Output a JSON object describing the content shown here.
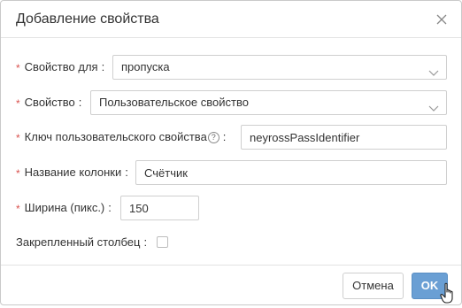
{
  "dialog": {
    "title": "Добавление свойства",
    "close_icon": "close-icon"
  },
  "form": {
    "required_mark": "*",
    "colon": ":",
    "property_for": {
      "label": "Свойство для",
      "value": "пропуска"
    },
    "property": {
      "label": "Свойство",
      "value": "Пользовательское свойство"
    },
    "custom_key": {
      "label": "Ключ пользовательского свойства",
      "help_icon": "help-icon",
      "help_glyph": "?",
      "value": "neyrossPassIdentifier"
    },
    "column_name": {
      "label": "Название колонки",
      "value": "Счётчик"
    },
    "width": {
      "label": "Ширина (пикс.)",
      "value": "150"
    },
    "pinned": {
      "label": "Закрепленный столбец",
      "checked": false
    }
  },
  "footer": {
    "cancel_label": "Отмена",
    "ok_label": "OK"
  }
}
